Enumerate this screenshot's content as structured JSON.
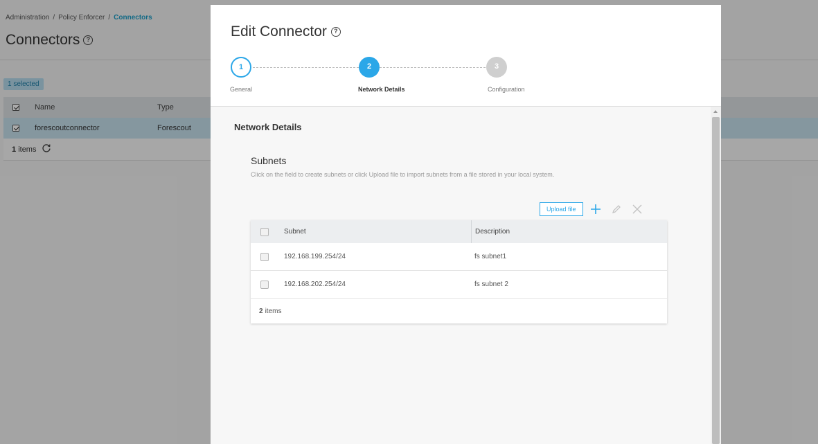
{
  "background": {
    "breadcrumb": [
      "Administration",
      "Policy Enforcer",
      "Connectors"
    ],
    "title": "Connectors",
    "selected_badge": "1 selected",
    "table": {
      "headers": [
        "Name",
        "Type"
      ],
      "rows": [
        {
          "name": "forescoutconnector",
          "type": "Forescout"
        }
      ],
      "footer_count": "1",
      "footer_label": "items"
    }
  },
  "modal": {
    "title": "Edit Connector",
    "steps": [
      {
        "number": "1",
        "label": "General",
        "state": "done"
      },
      {
        "number": "2",
        "label": "Network Details",
        "state": "active"
      },
      {
        "number": "3",
        "label": "Configuration",
        "state": "pending"
      }
    ],
    "section_title": "Network Details",
    "subnets": {
      "title": "Subnets",
      "description": "Click on the field to create subnets or click Upload file to import subnets from a file stored in your local system.",
      "upload_label": "Upload file",
      "columns": [
        "Subnet",
        "Description"
      ],
      "rows": [
        {
          "subnet": "192.168.199.254/24",
          "description": "fs subnet1"
        },
        {
          "subnet": "192.168.202.254/24",
          "description": "fs subnet 2"
        }
      ],
      "footer_count": "2",
      "footer_label": "items"
    }
  },
  "colors": {
    "accent": "#2ba7e8",
    "link": "#1e9fc8",
    "selected_row": "#c7e1ee",
    "pending_step": "#cfcfcf"
  },
  "icons": [
    "help-icon",
    "refresh-icon",
    "plus-icon",
    "edit-icon",
    "close-icon"
  ]
}
